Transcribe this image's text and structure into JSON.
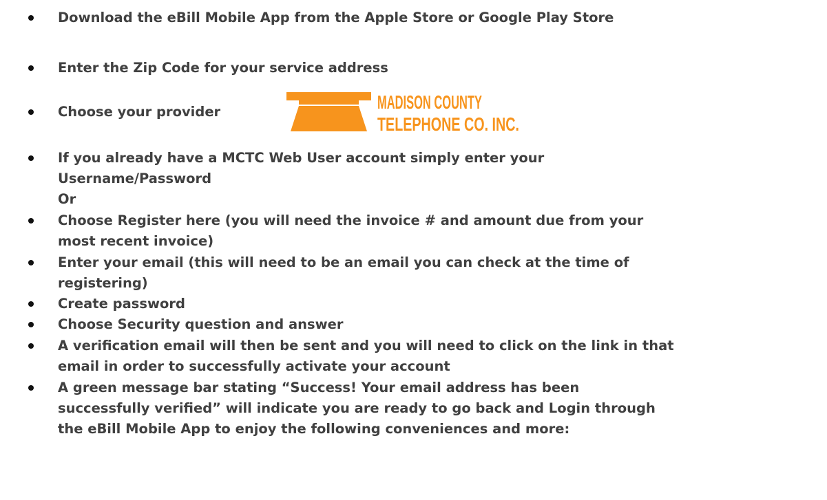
{
  "steps": [
    {
      "lines": [
        "Download the eBill Mobile App from the Apple Store or Google Play Store"
      ]
    },
    {
      "lines": [
        "Enter the Zip Code for your service address"
      ]
    },
    {
      "lines": [
        "Choose your provider"
      ]
    },
    {
      "lines": [
        "If you already have a MCTC Web User account simply enter your",
        "Username/Password",
        "Or"
      ]
    },
    {
      "lines": [
        "Choose Register here (you will need the invoice # and amount due from your",
        "most recent invoice)"
      ]
    },
    {
      "lines": [
        "Enter your email (this will need to be an email you can check at the time of",
        "registering)"
      ]
    },
    {
      "lines": [
        "Create password"
      ]
    },
    {
      "lines": [
        "Choose Security question and answer"
      ]
    },
    {
      "lines": [
        "A verification email will then be sent and you will need to click on the link in that",
        "email in order to successfully activate your account"
      ]
    },
    {
      "lines": [
        "A green message bar stating “Success! Your email address has been",
        "successfully verified” will indicate you are ready to go back and Login through",
        "the eBill Mobile App to enjoy the following conveniences and more:"
      ]
    }
  ],
  "logo": {
    "line1": "MADISON COUNTY",
    "line2": "TELEPHONE CO. INC.",
    "color": "#F7941D"
  }
}
